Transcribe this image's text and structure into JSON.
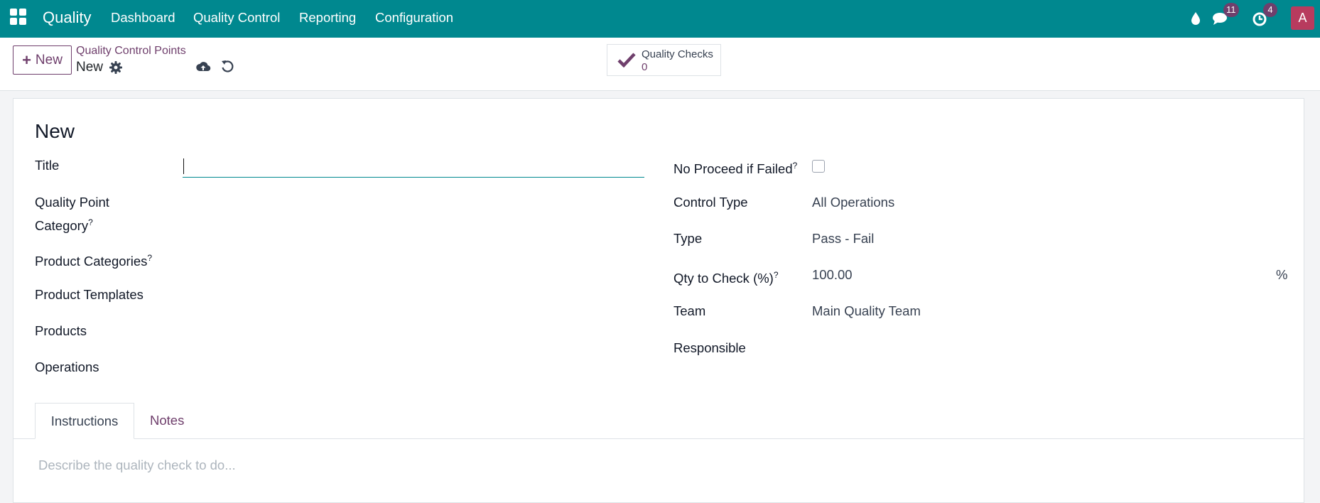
{
  "navbar": {
    "brand": "Quality",
    "menu": [
      "Dashboard",
      "Quality Control",
      "Reporting",
      "Configuration"
    ],
    "messages_badge": "11",
    "activities_badge": "4",
    "avatar_initial": "A"
  },
  "control_panel": {
    "new_button": "New",
    "breadcrumb": "Quality Control Points",
    "record_name": "New",
    "smart_button": {
      "label": "Quality Checks",
      "value": "0"
    }
  },
  "form": {
    "title": "New",
    "left_fields": {
      "title": "Title",
      "category_line1": "Quality Point",
      "category_line2": "Category",
      "product_categories": "Product Categories",
      "product_templates": "Product Templates",
      "products": "Products",
      "operations": "Operations"
    },
    "right_fields": {
      "no_proceed": "No Proceed if Failed",
      "control_type": "Control Type",
      "control_type_value": "All Operations",
      "type": "Type",
      "type_value": "Pass - Fail",
      "qty_to_check": "Qty to Check (%)",
      "qty_to_check_value": "100.00",
      "percent_symbol": "%",
      "team": "Team",
      "team_value": "Main Quality Team",
      "responsible": "Responsible"
    },
    "help_mark": "?",
    "tabs": [
      "Instructions",
      "Notes"
    ],
    "instructions_placeholder": "Describe the quality check to do..."
  },
  "colors": {
    "navbar": "#00888f",
    "accent": "#6f3f6c",
    "avatar": "#b83b5e"
  }
}
